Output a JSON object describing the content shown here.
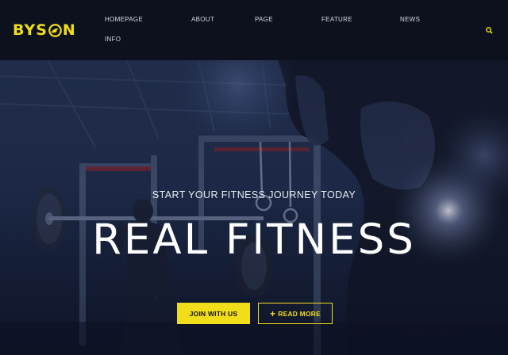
{
  "header": {
    "logo": {
      "left": "BYS",
      "right": "N"
    },
    "nav": [
      "HOMEPAGE",
      "ABOUT",
      "PAGE",
      "FEATURE",
      "NEWS",
      "INFO"
    ],
    "search_icon": "search-icon"
  },
  "hero": {
    "subtitle": "START YOUR FITNESS JOURNEY TODAY",
    "title": "REAL FITNESS",
    "join_label": "JOIN WITH US",
    "more_icon": "+",
    "more_label": "READ MORE"
  },
  "colors": {
    "accent": "#f2dd1a",
    "header_bg": "#0d111d",
    "hero_tint": "#1a2540"
  }
}
